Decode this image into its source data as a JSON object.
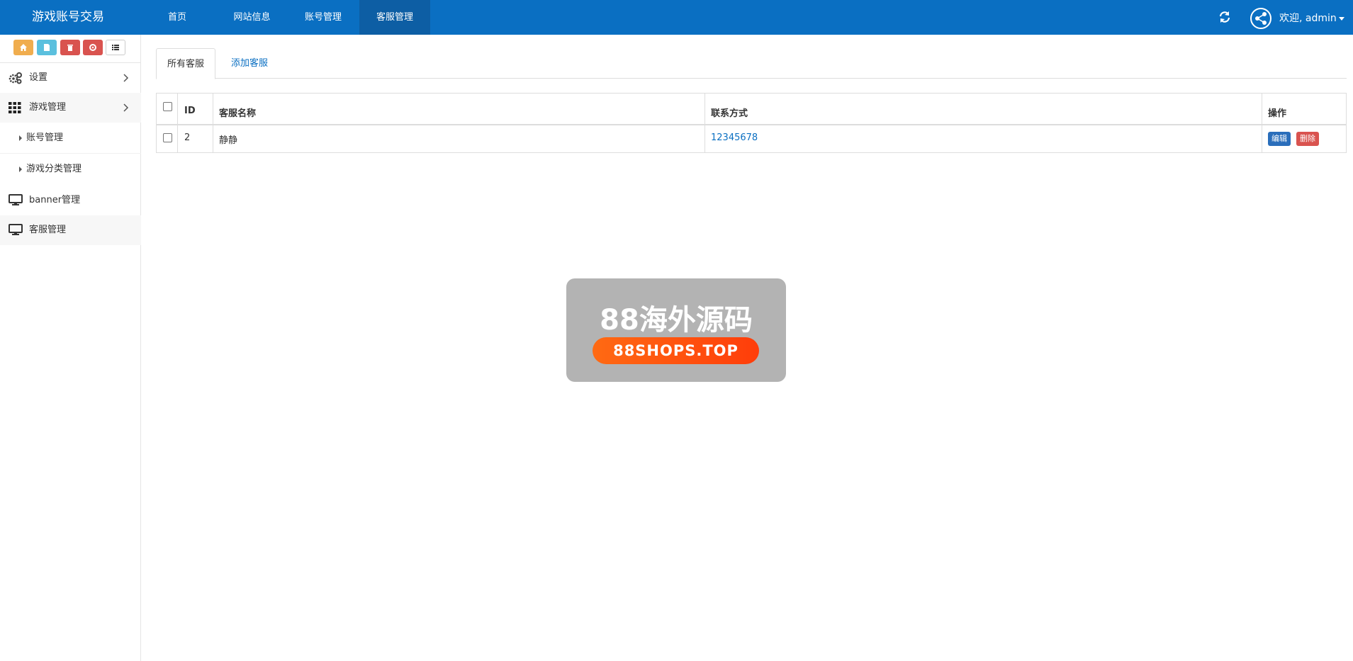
{
  "navbar": {
    "brand": "游戏账号交易",
    "items": [
      {
        "label": "首页",
        "active": false
      },
      {
        "label": "网站信息",
        "active": false
      },
      {
        "label": "账号管理",
        "active": false
      },
      {
        "label": "客服管理",
        "active": true
      }
    ],
    "user_label": "欢迎, admin",
    "color": "#0a6fc2"
  },
  "sidebar": {
    "shortcut_icons": [
      {
        "icon": "home-icon",
        "color": "#f0ad4e"
      },
      {
        "icon": "file-icon",
        "color": "#5bc0de"
      },
      {
        "icon": "trash-icon",
        "color": "#d9534f"
      },
      {
        "icon": "recycle-icon",
        "color": "#d9534f"
      },
      {
        "icon": "list-icon",
        "color": "#ffffff"
      }
    ],
    "menu": [
      {
        "label": "设置",
        "icon": "gears-icon"
      },
      {
        "label": "游戏管理",
        "icon": "grid-icon"
      },
      {
        "label": "账号管理",
        "sub": true
      },
      {
        "label": "游戏分类管理",
        "sub": true
      },
      {
        "label": "banner管理",
        "icon": "desktop-icon"
      },
      {
        "label": "客服管理",
        "icon": "desktop-icon"
      }
    ]
  },
  "tabs": [
    {
      "label": "所有客服",
      "active": true
    },
    {
      "label": "添加客服",
      "active": false
    }
  ],
  "table": {
    "headers": [
      "ID",
      "客服名称",
      "联系方式",
      "操作"
    ],
    "rows": [
      {
        "id": "2",
        "name": "静静",
        "contact": "12345678",
        "edit_label": "编辑",
        "delete_label": "删除"
      }
    ]
  },
  "watermark": {
    "title": "88海外源码",
    "url": "88SHOPS.TOP"
  }
}
